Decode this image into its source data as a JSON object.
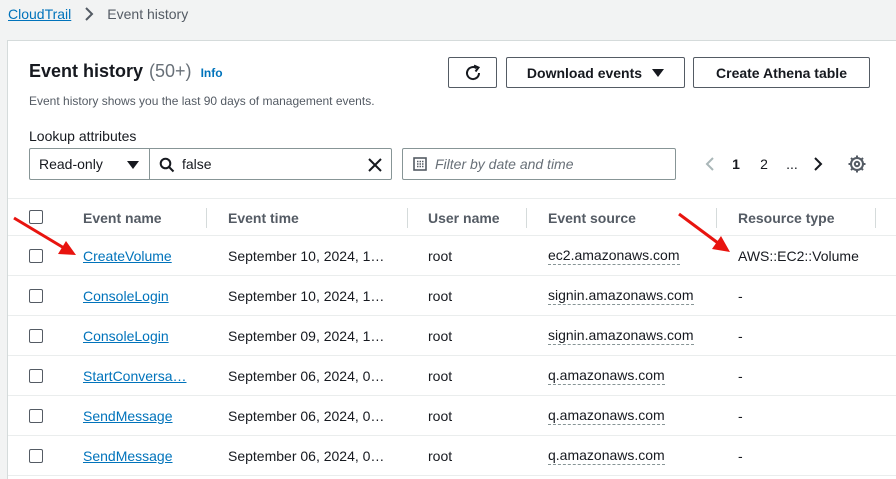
{
  "breadcrumb": {
    "root": "CloudTrail",
    "current": "Event history"
  },
  "header": {
    "title": "Event history",
    "count": "(50+)",
    "info": "Info",
    "description": "Event history shows you the last 90 days of management events."
  },
  "buttons": {
    "refresh_icon": "refresh-icon",
    "download": "Download events",
    "athena": "Create Athena table"
  },
  "filters": {
    "lookup_label": "Lookup attributes",
    "attribute": "Read-only",
    "search_value": "false",
    "date_placeholder": "Filter by date and time"
  },
  "pagination": {
    "pages": [
      "1",
      "2",
      "..."
    ],
    "current": "1"
  },
  "table": {
    "columns": [
      "Event name",
      "Event time",
      "User name",
      "Event source",
      "Resource type"
    ],
    "rows": [
      {
        "event_name": "CreateVolume",
        "event_time": "September 10, 2024, 1…",
        "user": "root",
        "source": "ec2.amazonaws.com",
        "resource_type": "AWS::EC2::Volume"
      },
      {
        "event_name": "ConsoleLogin",
        "event_time": "September 10, 2024, 1…",
        "user": "root",
        "source": "signin.amazonaws.com",
        "resource_type": "-"
      },
      {
        "event_name": "ConsoleLogin",
        "event_time": "September 09, 2024, 1…",
        "user": "root",
        "source": "signin.amazonaws.com",
        "resource_type": "-"
      },
      {
        "event_name": "StartConversa…",
        "event_time": "September 06, 2024, 0…",
        "user": "root",
        "source": "q.amazonaws.com",
        "resource_type": "-"
      },
      {
        "event_name": "SendMessage",
        "event_time": "September 06, 2024, 0…",
        "user": "root",
        "source": "q.amazonaws.com",
        "resource_type": "-"
      },
      {
        "event_name": "SendMessage",
        "event_time": "September 06, 2024, 0…",
        "user": "root",
        "source": "q.amazonaws.com",
        "resource_type": "-"
      }
    ]
  },
  "colors": {
    "link": "#0073bb",
    "annotation": "#e8140f",
    "border": "#879596"
  }
}
